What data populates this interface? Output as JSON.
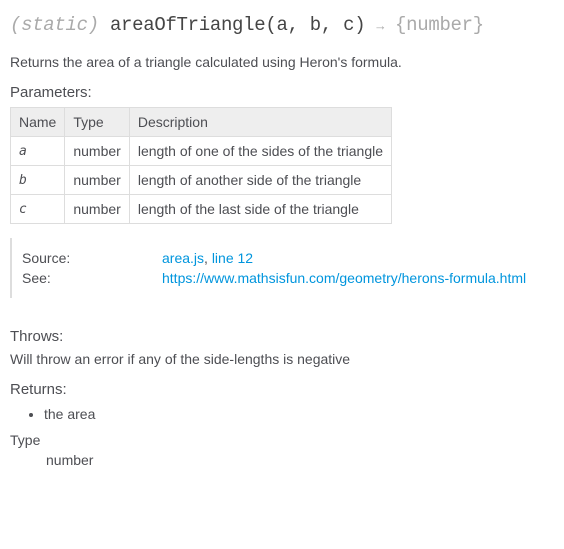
{
  "signature": {
    "attrib": "(static)",
    "name": "areaOfTriangle",
    "params": "(a, b, c)",
    "arrow": "→",
    "returntype": "{number}"
  },
  "description": "Returns the area of a triangle calculated using Heron's formula.",
  "sections": {
    "parameters": "Parameters:",
    "throws": "Throws:",
    "returns": "Returns:"
  },
  "paramsTable": {
    "headers": {
      "name": "Name",
      "type": "Type",
      "description": "Description"
    },
    "rows": [
      {
        "name": "a",
        "type": "number",
        "desc": "length of one of the sides of the triangle"
      },
      {
        "name": "b",
        "type": "number",
        "desc": "length of another side of the triangle"
      },
      {
        "name": "c",
        "type": "number",
        "desc": "length of the last side of the triangle"
      }
    ]
  },
  "details": {
    "sourceLabel": "Source:",
    "sourceFile": "area.js",
    "sourceSep": ", ",
    "sourceLine": "line 12",
    "seeLabel": "See:",
    "seeLink": "https://www.mathsisfun.com/geometry/herons-formula.html"
  },
  "throwsText": "Will throw an error if any of the side-lengths is negative",
  "returns": {
    "item": "the area",
    "typeLabel": "Type",
    "typeValue": "number"
  }
}
